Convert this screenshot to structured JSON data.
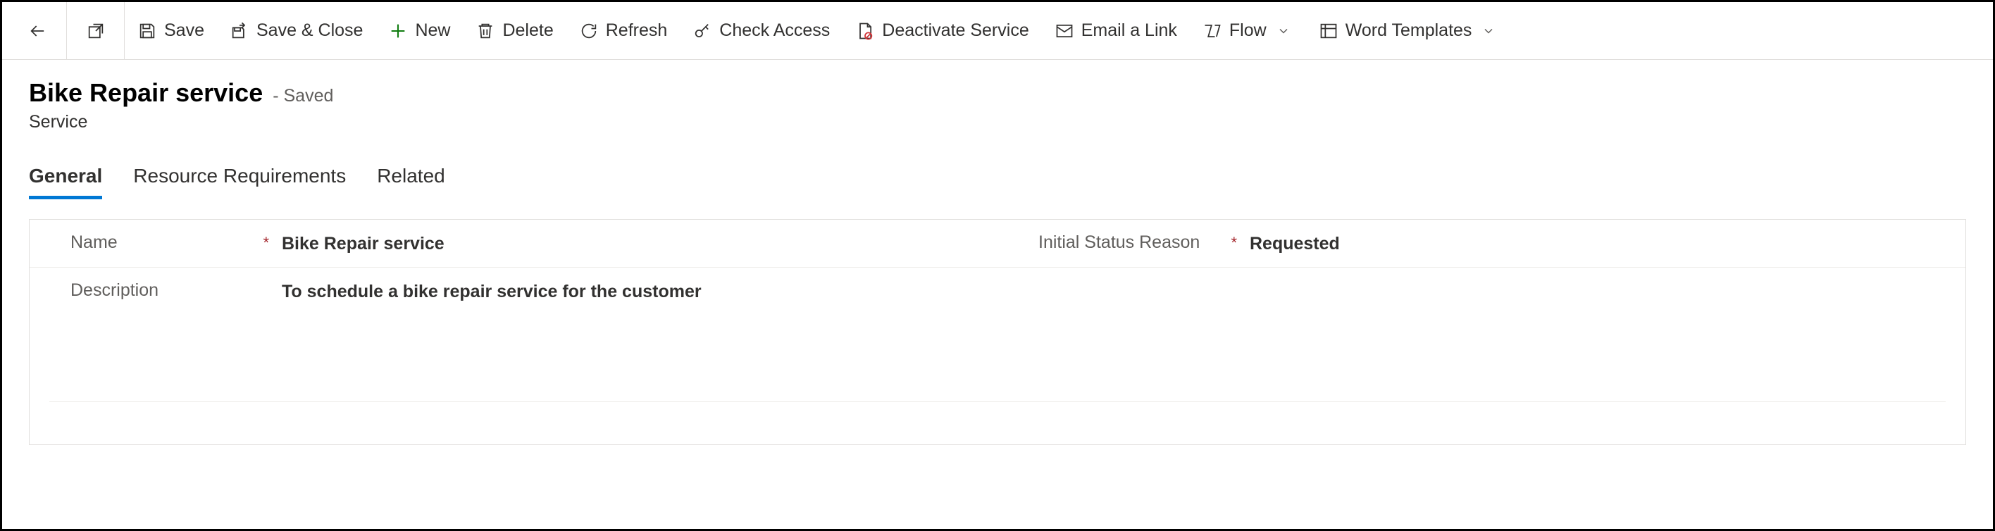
{
  "toolbar": {
    "save": "Save",
    "save_close": "Save & Close",
    "new": "New",
    "delete": "Delete",
    "refresh": "Refresh",
    "check_access": "Check Access",
    "deactivate": "Deactivate Service",
    "email_link": "Email a Link",
    "flow": "Flow",
    "word_templates": "Word Templates"
  },
  "header": {
    "title": "Bike Repair service",
    "status": "- Saved",
    "entity": "Service"
  },
  "tabs": {
    "general": "General",
    "resource_requirements": "Resource Requirements",
    "related": "Related"
  },
  "form": {
    "name_label": "Name",
    "name_value": "Bike Repair service",
    "status_label": "Initial Status Reason",
    "status_value": "Requested",
    "description_label": "Description",
    "description_value": "To schedule a bike repair service for the customer",
    "required": "*"
  }
}
